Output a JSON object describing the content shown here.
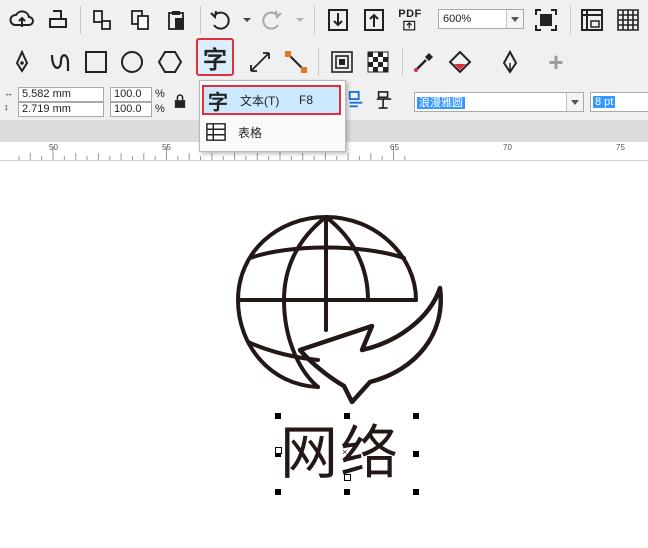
{
  "toolbar_top": {
    "zoom_value": "600%",
    "pdf_label": "PDF"
  },
  "toolbar_tools": {
    "text_tool_glyph": "字",
    "add_label": "+"
  },
  "property_bar": {
    "width_value": "5.582 mm",
    "height_value": "2.719 mm",
    "scale_x": "100.0",
    "scale_y": "100.0",
    "percent": "%",
    "font_name": "浪漫雅圆",
    "font_size": "8 pt"
  },
  "flyout_menu": {
    "items": [
      {
        "glyph": "字",
        "label": "文本(T)",
        "shortcut": "F8"
      },
      {
        "label": "表格"
      }
    ]
  },
  "ruler": {
    "ticks": [
      "50",
      "55",
      "60",
      "65",
      "70",
      "75"
    ]
  },
  "canvas": {
    "logo_text": "网络"
  },
  "colors": {
    "accent_red": "#e0303a",
    "highlight_blue": "#cce8ff",
    "selection_blue": "#3399ff"
  }
}
